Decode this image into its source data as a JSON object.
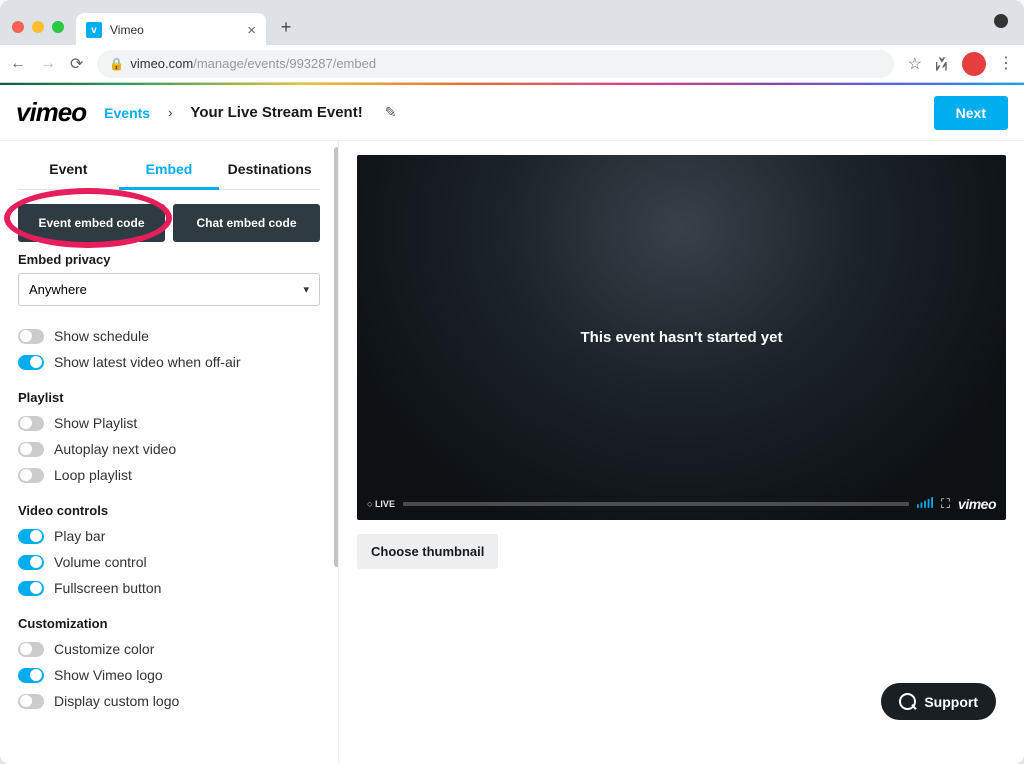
{
  "browser": {
    "tab_title": "Vimeo",
    "url_domain": "vimeo.com",
    "url_path": "/manage/events/993287/embed"
  },
  "header": {
    "logo": "vimeo",
    "breadcrumb_link": "Events",
    "breadcrumb_title": "Your Live Stream Event!",
    "next_button": "Next"
  },
  "tabs": {
    "event": "Event",
    "embed": "Embed",
    "destinations": "Destinations"
  },
  "embed_buttons": {
    "event": "Event embed code",
    "chat": "Chat embed code"
  },
  "embed_privacy": {
    "label": "Embed privacy",
    "value": "Anywhere"
  },
  "toggles": {
    "show_schedule": "Show schedule",
    "latest_offair": "Show latest video when off-air",
    "playlist_header": "Playlist",
    "show_playlist": "Show Playlist",
    "autoplay_next": "Autoplay next video",
    "loop_playlist": "Loop playlist",
    "video_controls_header": "Video controls",
    "play_bar": "Play bar",
    "volume": "Volume control",
    "fullscreen": "Fullscreen button",
    "customization_header": "Customization",
    "custom_color": "Customize color",
    "show_logo": "Show Vimeo logo",
    "custom_logo": "Display custom logo"
  },
  "player": {
    "message": "This event hasn't started yet",
    "live_label": "LIVE",
    "brand": "vimeo"
  },
  "choose_thumbnail": "Choose thumbnail",
  "support": "Support"
}
